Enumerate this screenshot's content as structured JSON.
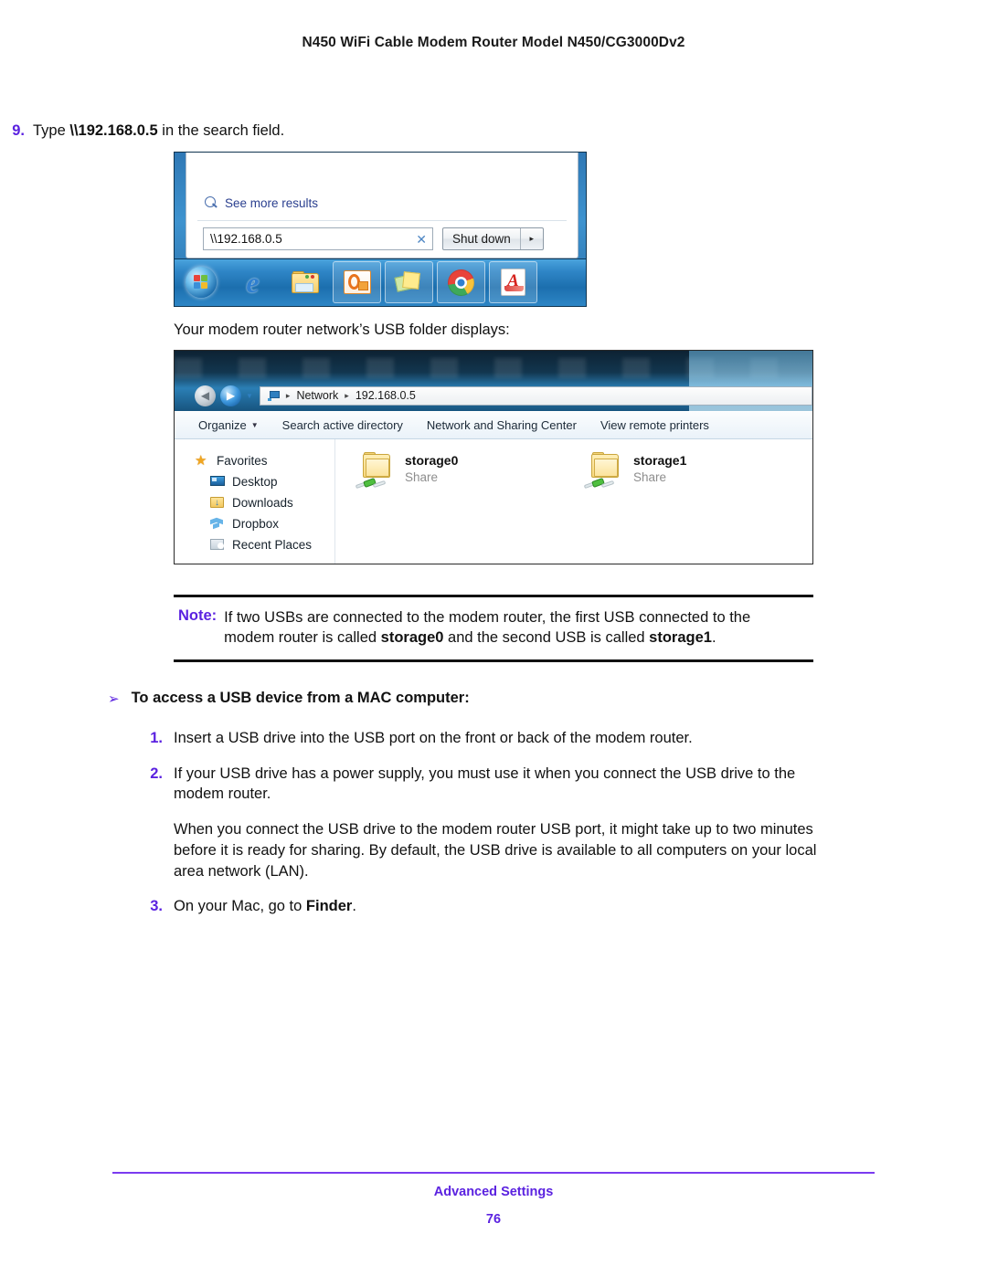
{
  "header": {
    "title": "N450 WiFi Cable Modem Router Model N450/CG3000Dv2"
  },
  "step9": {
    "number": "9.",
    "text_before": "Type ",
    "text_bold": "\\\\192.168.0.5",
    "text_after": " in the search field."
  },
  "start_menu": {
    "see_more_results": "See more results",
    "search_value": "\\\\192.168.0.5",
    "clear_icon": "clear-icon",
    "shutdown_label": "Shut down",
    "shutdown_arrow": "▸",
    "taskbar": [
      {
        "name": "start-orb-icon",
        "label": "Start"
      },
      {
        "name": "internet-explorer-icon",
        "label": "Internet Explorer"
      },
      {
        "name": "windows-explorer-icon",
        "label": "Windows Explorer"
      },
      {
        "name": "outlook-icon",
        "label": "Microsoft Outlook"
      },
      {
        "name": "sticky-notes-icon",
        "label": "Sticky Notes"
      },
      {
        "name": "chrome-icon",
        "label": "Google Chrome"
      },
      {
        "name": "acrobat-icon",
        "label": "Adobe Acrobat"
      }
    ]
  },
  "caption": "Your modem router network’s USB folder displays:",
  "explorer": {
    "breadcrumb": {
      "root": "Network",
      "child": "192.168.0.5",
      "separator": "▸"
    },
    "toolbar": [
      "Organize",
      "Search active directory",
      "Network and Sharing Center",
      "View remote printers"
    ],
    "nav_pane": [
      {
        "label": "Favorites",
        "icon": "star-icon"
      },
      {
        "label": "Desktop",
        "icon": "desktop-icon"
      },
      {
        "label": "Downloads",
        "icon": "downloads-icon"
      },
      {
        "label": "Dropbox",
        "icon": "dropbox-icon"
      },
      {
        "label": "Recent Places",
        "icon": "recent-places-icon"
      }
    ],
    "shares": [
      {
        "name": "storage0",
        "type": "Share"
      },
      {
        "name": "storage1",
        "type": "Share"
      }
    ]
  },
  "note": {
    "label": "Note:",
    "p1": "If two USBs are connected to the modem router, the first USB connected to the modem router is called ",
    "b1": "storage0",
    "p2": " and the second USB is called ",
    "b2": "storage1",
    "p3": "."
  },
  "task": {
    "arrow": "➢",
    "title": "To access a USB device from a MAC computer:",
    "steps": [
      {
        "number": "1.",
        "text": "Insert a USB drive into the USB port on the front or back of the modem router."
      },
      {
        "number": "2.",
        "text": "If your USB drive has a power supply, you must use it when you connect the USB drive to the modem router."
      },
      {
        "number": "",
        "text": "When you connect the USB drive to the modem router USB port, it might take up to two minutes before it is ready for sharing. By default, the USB drive is available to all computers on your local area network (LAN)."
      },
      {
        "number": "3.",
        "text_before": "On your Mac, go to ",
        "text_bold": "Finder",
        "text_after": "."
      }
    ]
  },
  "footer": {
    "title": "Advanced Settings",
    "page": "76"
  },
  "colors": {
    "accent_purple": "#5B22E0",
    "footer_rule": "#7B3BF0"
  }
}
